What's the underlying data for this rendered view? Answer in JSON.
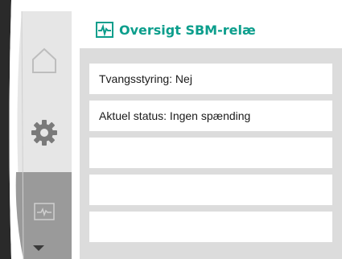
{
  "header": {
    "title": "Oversigt SBM-relæ",
    "icon": "pulse-icon"
  },
  "rail": {
    "items": [
      {
        "icon": "home-icon"
      },
      {
        "icon": "gear-icon"
      },
      {
        "icon": "pulse-icon",
        "selected": true
      },
      {
        "icon": "arrow-down-icon"
      }
    ]
  },
  "list": {
    "rows": [
      {
        "label": "Tvangsstyring: Nej"
      },
      {
        "label": "Aktuel status: Ingen spænding"
      },
      {
        "label": ""
      },
      {
        "label": ""
      },
      {
        "label": ""
      }
    ]
  },
  "colors": {
    "accent": "#0c9e8c",
    "list_background": "#dcdcdc",
    "rail_background": "#e6e6e6",
    "rail_selected": "#9a9a9a",
    "bezel": "#2a2a2a"
  }
}
